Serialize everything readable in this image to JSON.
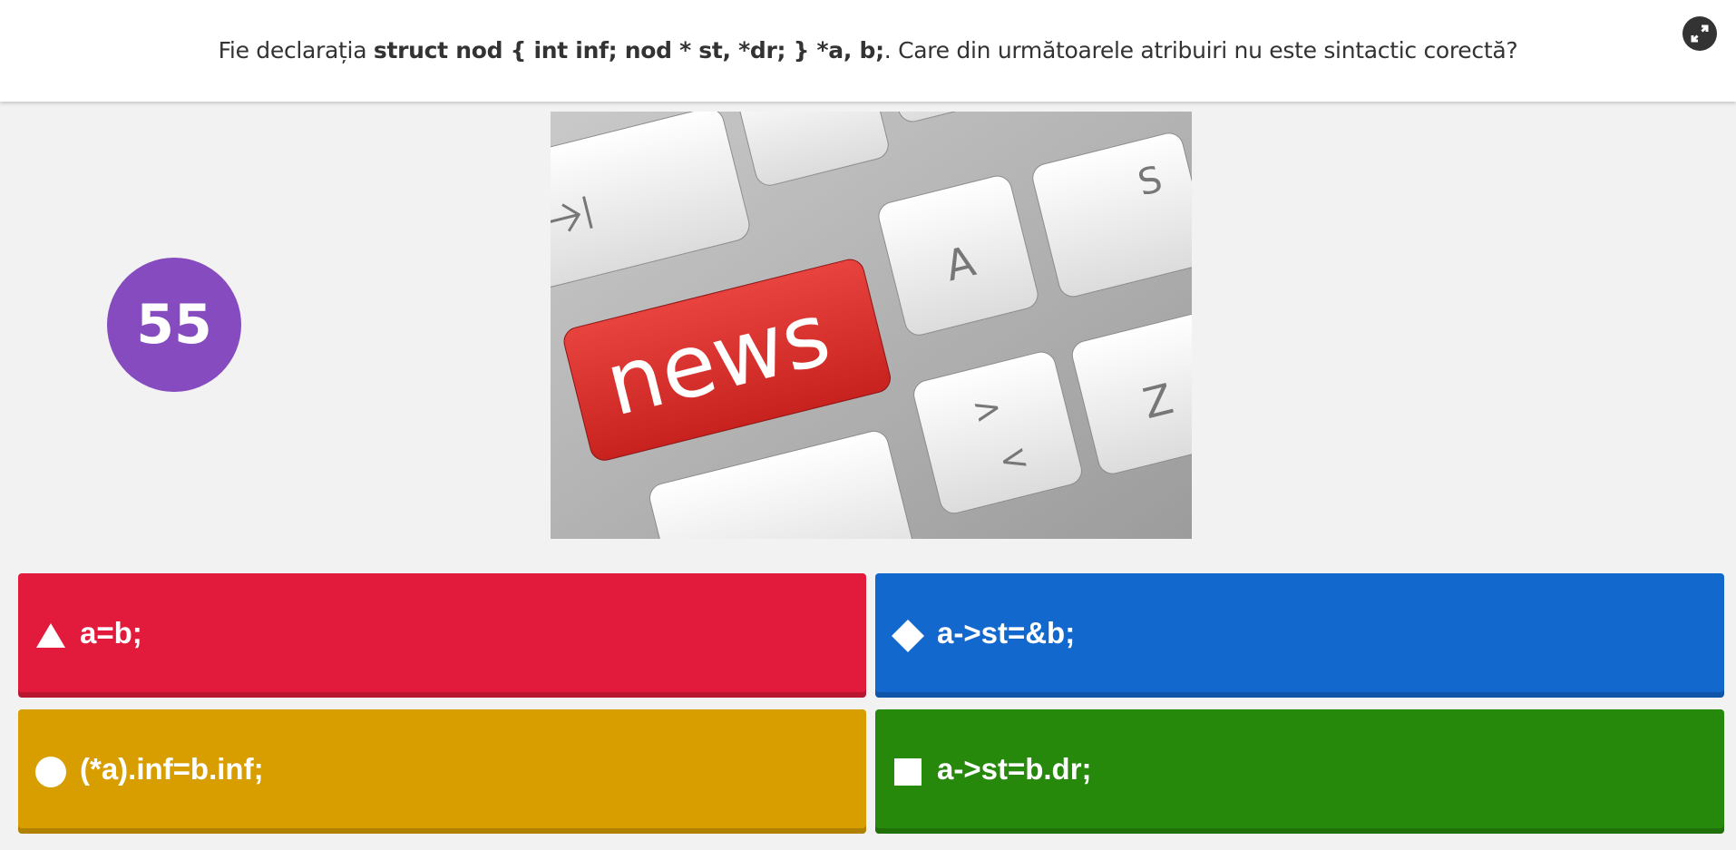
{
  "question": {
    "prefix": "Fie declarația ",
    "code": "struct nod { int inf; nod * st, *dr; } *a, b;",
    "suffix": ". Care din următoarele atribuiri nu este sintactic corectă?"
  },
  "timer": {
    "value": "55"
  },
  "media": {
    "key_label": "news",
    "key_letters": [
      "A",
      "Z",
      ">",
      "<",
      "S"
    ]
  },
  "answers": [
    {
      "label": "a=b;",
      "shape": "triangle-icon",
      "color": "#e21b3c"
    },
    {
      "label": "a->st=&b;",
      "shape": "diamond-icon",
      "color": "#1368ce"
    },
    {
      "label": "(*a).inf=b.inf;",
      "shape": "circle-icon",
      "color": "#d89e00"
    },
    {
      "label": "a->st=b.dr;",
      "shape": "square-icon",
      "color": "#26890c"
    }
  ],
  "colors": {
    "timer": "#864cbf",
    "header_text": "#333333",
    "background": "#f2f2f2"
  },
  "icons": {
    "fullscreen": "fullscreen-icon"
  }
}
